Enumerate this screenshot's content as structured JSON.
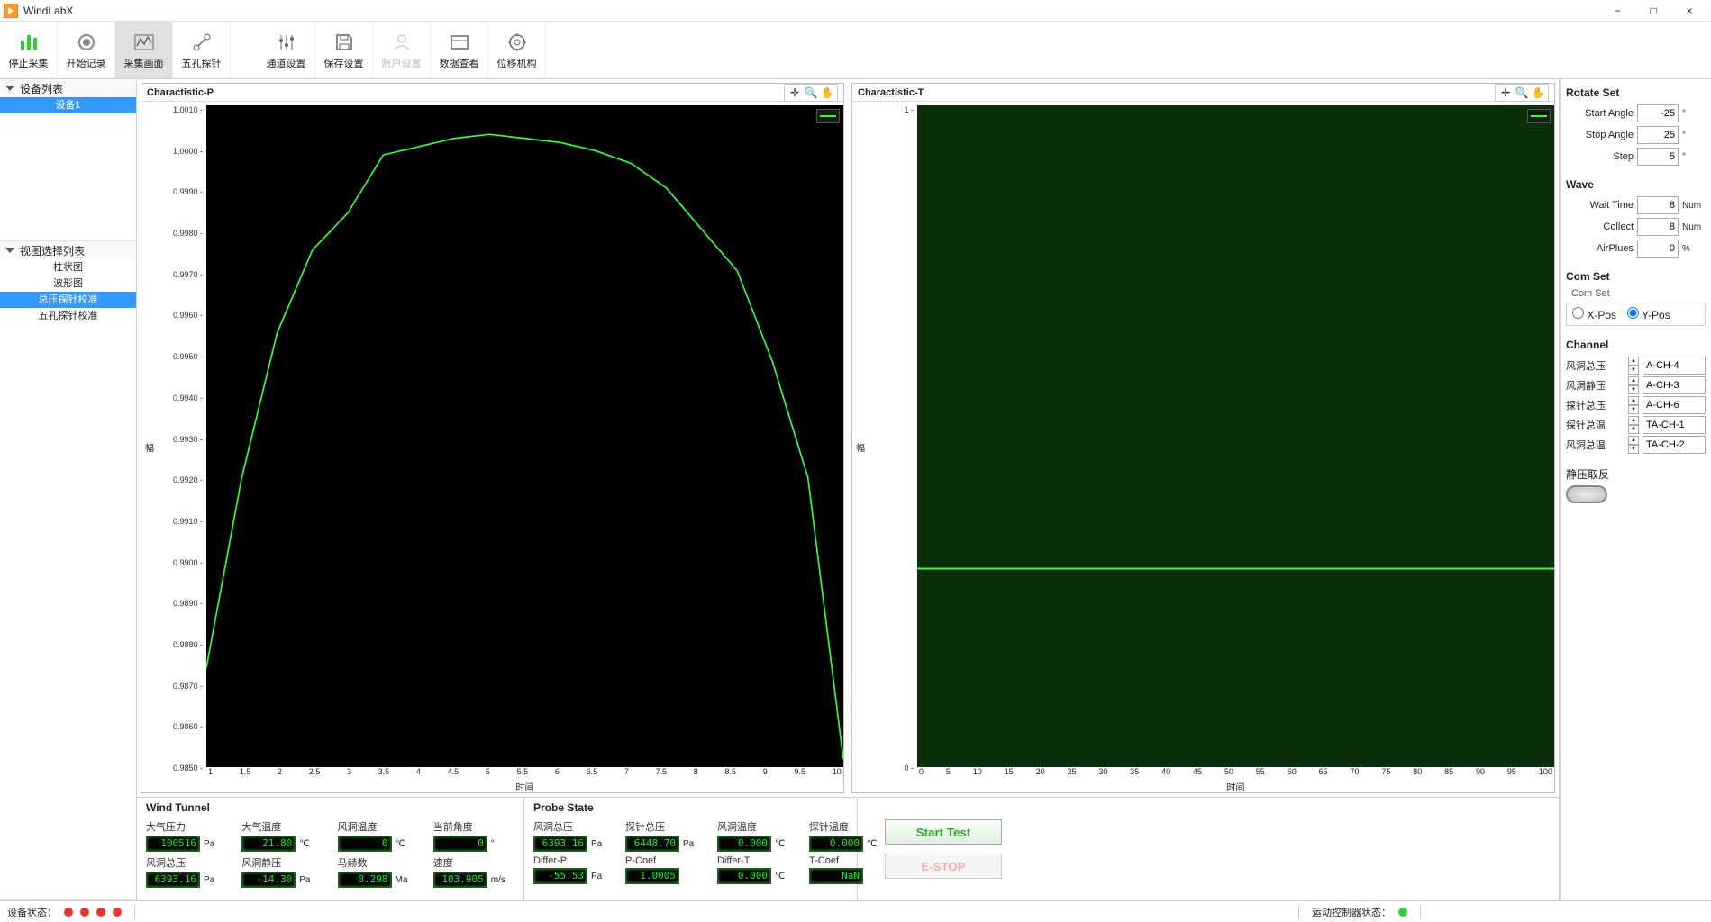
{
  "app": {
    "title": "WindLabX"
  },
  "window": {
    "minimize": "−",
    "maximize": "□",
    "close": "×"
  },
  "toolbar": {
    "items": [
      {
        "id": "stop-acq",
        "label": "停止采集"
      },
      {
        "id": "start-rec",
        "label": "开始记录"
      },
      {
        "id": "acq-screen",
        "label": "采集画面"
      },
      {
        "id": "five-hole",
        "label": "五孔探针"
      },
      {
        "id": "channel-set",
        "label": "通道设置"
      },
      {
        "id": "save-set",
        "label": "保存设置"
      },
      {
        "id": "account-set",
        "label": "账户设置"
      },
      {
        "id": "data-view",
        "label": "数据查看"
      },
      {
        "id": "displacer",
        "label": "位移机构"
      }
    ]
  },
  "sidebar": {
    "devices_title": "设备列表",
    "devices": [
      "设备1"
    ],
    "views_title": "视图选择列表",
    "views": [
      "柱状图",
      "波形图",
      "总压探针校准",
      "五孔探针校准"
    ],
    "selected_view": "总压探针校准"
  },
  "charts": {
    "left": {
      "title": "Charactistic-P",
      "ylabel": "幅",
      "xlabel": "时间",
      "yticks": [
        "1.0010",
        "1.0000",
        "0.9990",
        "0.9980",
        "0.9970",
        "0.9960",
        "0.9950",
        "0.9940",
        "0.9930",
        "0.9920",
        "0.9910",
        "0.9900",
        "0.9890",
        "0.9880",
        "0.9870",
        "0.9860",
        "0.9850"
      ],
      "xticks": [
        "1",
        "1.5",
        "2",
        "2.5",
        "3",
        "3.5",
        "4",
        "4.5",
        "5",
        "5.5",
        "6",
        "6.5",
        "7",
        "7.5",
        "8",
        "8.5",
        "9",
        "9.5",
        "10"
      ]
    },
    "right": {
      "title": "Charactistic-T",
      "ylabel": "幅",
      "xlabel": "时间",
      "yticks": [
        "1",
        "0"
      ],
      "xticks": [
        "0",
        "5",
        "10",
        "15",
        "20",
        "25",
        "30",
        "35",
        "40",
        "45",
        "50",
        "55",
        "60",
        "65",
        "70",
        "75",
        "80",
        "85",
        "90",
        "95",
        "100"
      ]
    }
  },
  "chart_data": [
    {
      "type": "line",
      "title": "Charactistic-P",
      "xlabel": "时间",
      "ylabel": "幅",
      "x": [
        1,
        1.5,
        2,
        2.5,
        3,
        3.5,
        4,
        4.5,
        5,
        5.5,
        6,
        6.5,
        7,
        7.5,
        8,
        8.5,
        9,
        9.5,
        10
      ],
      "values": [
        0.9874,
        0.992,
        0.9955,
        0.9975,
        0.9984,
        0.9998,
        1.0,
        1.0002,
        1.0003,
        1.0002,
        1.0001,
        0.9999,
        0.9996,
        0.999,
        0.998,
        0.997,
        0.9948,
        0.992,
        0.9852
      ],
      "ylim": [
        0.985,
        1.001
      ]
    },
    {
      "type": "line",
      "title": "Charactistic-T",
      "xlabel": "时间",
      "ylabel": "幅",
      "x": [
        0,
        5,
        10,
        15,
        20,
        25,
        30,
        35,
        40,
        45,
        50,
        55,
        60,
        65,
        70,
        75,
        80,
        85,
        90,
        95,
        100
      ],
      "values": [
        0.3,
        0.3,
        0.3,
        0.3,
        0.3,
        0.3,
        0.3,
        0.3,
        0.3,
        0.3,
        0.3,
        0.3,
        0.3,
        0.3,
        0.3,
        0.3,
        0.3,
        0.3,
        0.3,
        0.3,
        0.3
      ],
      "ylim": [
        0,
        1
      ]
    }
  ],
  "bottom": {
    "wind_title": "Wind Tunnel",
    "probe_title": "Probe State",
    "wind": {
      "a": {
        "l": "大气压力",
        "v": "100516",
        "u": "Pa"
      },
      "b": {
        "l": "大气温度",
        "v": "21.80",
        "u": "℃"
      },
      "c": {
        "l": "风洞温度",
        "v": "0",
        "u": "℃"
      },
      "d": {
        "l": "当前角度",
        "v": "0",
        "u": "°"
      },
      "e": {
        "l": "风洞总压",
        "v": "6393.16",
        "u": "Pa"
      },
      "f": {
        "l": "风洞静压",
        "v": "-14.30",
        "u": "Pa"
      },
      "g": {
        "l": "马赫数",
        "v": "0.298",
        "u": "Ma"
      },
      "h": {
        "l": "速度",
        "v": "103.905",
        "u": "m/s"
      }
    },
    "probe": {
      "a": {
        "l": "风洞总压",
        "v": "6393.16",
        "u": "Pa"
      },
      "b": {
        "l": "探针总压",
        "v": "6448.70",
        "u": "Pa"
      },
      "c": {
        "l": "风洞温度",
        "v": "0.000",
        "u": "℃"
      },
      "d": {
        "l": "探针温度",
        "v": "0.000",
        "u": "℃"
      },
      "e": {
        "l": "Differ-P",
        "v": "-55.53",
        "u": "Pa"
      },
      "f": {
        "l": "P-Coef",
        "v": "1.0005",
        "u": ""
      },
      "g": {
        "l": "Differ-T",
        "v": "0.000",
        "u": "℃"
      },
      "h": {
        "l": "T-Coef",
        "v": "NaN",
        "u": ""
      }
    },
    "start": "Start Test",
    "estop": "E-STOP"
  },
  "right": {
    "rotate": {
      "title": "Rotate Set",
      "start": {
        "l": "Start Angle",
        "v": "-25",
        "u": "°"
      },
      "stop": {
        "l": "Stop Angle",
        "v": "25",
        "u": "°"
      },
      "step": {
        "l": "Step",
        "v": "5",
        "u": "°"
      }
    },
    "wave": {
      "title": "Wave",
      "wait": {
        "l": "Wait Time",
        "v": "8",
        "u": "Num"
      },
      "collect": {
        "l": "Collect",
        "v": "8",
        "u": "Num"
      },
      "air": {
        "l": "AirPlues",
        "v": "0",
        "u": "%"
      }
    },
    "com": {
      "title": "Com Set",
      "sub": "Com Set",
      "xpos": "X-Pos",
      "ypos": "Y-Pos"
    },
    "channel": {
      "title": "Channel",
      "rows": [
        {
          "l": "风洞总压",
          "v": "A-CH-4"
        },
        {
          "l": "风洞静压",
          "v": "A-CH-3"
        },
        {
          "l": "探针总压",
          "v": "A-CH-6"
        },
        {
          "l": "探针总温",
          "v": "TA-CH-1"
        },
        {
          "l": "风洞总温",
          "v": "TA-CH-2"
        }
      ]
    },
    "invert": "静压取反"
  },
  "status": {
    "dev": "设备状态：",
    "ctrl": "运动控制器状态："
  }
}
